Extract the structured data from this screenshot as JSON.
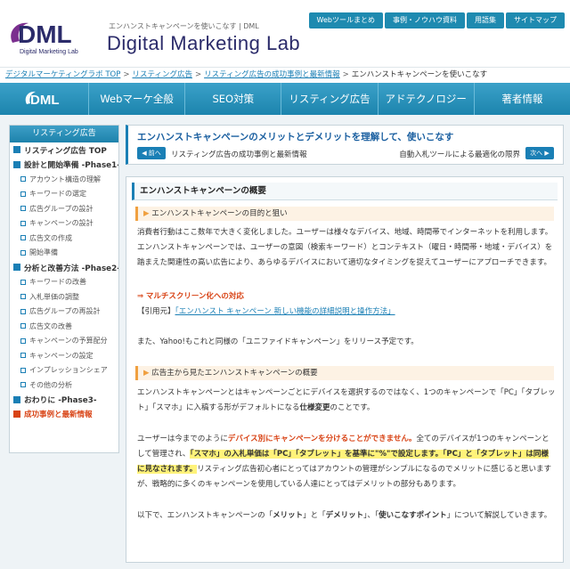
{
  "header": {
    "logo_mark": "DML",
    "logo_subtext": "Digital Marketing Lab",
    "tagline": "エンハンストキャンペーンを使いこなす | DML",
    "site_title": "Digital Marketing Lab",
    "top_nav": [
      "Webツールまとめ",
      "事例・ノウハウ資料",
      "用語集",
      "サイトマップ"
    ]
  },
  "breadcrumb": {
    "items": [
      "デジタルマーケティングラボ TOP",
      "リスティング広告",
      "リスティング広告の成功事例と最新情報"
    ],
    "separator": ">",
    "current": "エンハンストキャンペーンを使いこなす"
  },
  "main_nav": {
    "logo": "DML",
    "items": [
      "Webマーケ全般",
      "SEO対策",
      "リスティング広告",
      "アドテクノロジー",
      "著者情報"
    ]
  },
  "sidebar": {
    "title": "リスティング広告",
    "items": [
      {
        "label": "リスティング広告 TOP",
        "level": "top"
      },
      {
        "label": "設計と開始準備 -Phase1-",
        "level": "top"
      },
      {
        "label": "アカウント構造の理解",
        "level": "sub"
      },
      {
        "label": "キーワードの選定",
        "level": "sub"
      },
      {
        "label": "広告グループの設計",
        "level": "sub"
      },
      {
        "label": "キャンペーンの設計",
        "level": "sub"
      },
      {
        "label": "広告文の作成",
        "level": "sub"
      },
      {
        "label": "開始準備",
        "level": "sub"
      },
      {
        "label": "分析と改善方法 -Phase2-",
        "level": "top"
      },
      {
        "label": "キーワードの改善",
        "level": "sub"
      },
      {
        "label": "入札単価の調整",
        "level": "sub"
      },
      {
        "label": "広告グループの再設計",
        "level": "sub"
      },
      {
        "label": "広告文の改善",
        "level": "sub"
      },
      {
        "label": "キャンペーンの予算配分",
        "level": "sub"
      },
      {
        "label": "キャンペーンの設定",
        "level": "sub"
      },
      {
        "label": "インプレッションシェア",
        "level": "sub"
      },
      {
        "label": "その他の分析",
        "level": "sub"
      },
      {
        "label": "おわりに -Phase3-",
        "level": "top"
      },
      {
        "label": "成功事例と最新情報",
        "level": "accent"
      }
    ]
  },
  "article": {
    "title": "エンハンストキャンペーンのメリットとデメリットを理解して、使いこなす",
    "prev_button": "◀ 前へ",
    "prev_title": "リスティング広告の成功事例と最新情報",
    "next_button": "次へ ▶",
    "next_title": "自動入札ツールによる最適化の限界",
    "section_title": "エンハンストキャンペーンの概要",
    "sub1_title": "エンハンストキャンペーンの目的と狙い",
    "p1": "消費者行動はここ数年で大きく変化しました。ユーザーは様々なデバイス、地域、時間帯でインターネットを利用します。エンハンストキャンペーンでは、ユーザーの意図（検索キーワード）とコンテキスト（曜日・時間帯・地域・デバイス）を踏まえた関連性の高い広告により、あらゆるデバイスにおいて適切なタイミングを捉えてユーザーにアプローチできます。",
    "arrow": "⇒",
    "multiscreen": "マルチスクリーン化への対応",
    "quote_label": "【引用元】",
    "quote_link": "「エンハンスト キャンペーン 新しい機能の詳細説明と操作方法」",
    "p2": "また、Yahoo!もこれと同様の「ユニファイドキャンペーン」をリリース予定です。",
    "sub2_title": "広告主から見たエンハンストキャンペーンの概要",
    "p3_a": "エンハンストキャンペーンとはキャンペーンごとにデバイスを選択するのではなく、1つのキャンペーンで「PC」「タブレット」「スマホ」に入稿する形がデフォルトになる",
    "p3_b": "仕様変更",
    "p3_c": "のことです。",
    "p4_a": "ユーザーは今までのように",
    "p4_b": "デバイス別にキャンペーンを分けることができません。",
    "p4_c": "全てのデバイスが1つのキャンペーンとして管理され、",
    "p4_d": "「スマホ」の入札単価は「PC」「タブレット」を基準に\"%\"で設定します。",
    "p4_e": "「PC」と「タブレット」は同様に見なされます。",
    "p4_f": "リスティング広告初心者にとってはアカウントの管理がシンプルになるのでメリットに感じると思いますが、戦略的に多くのキャンペーンを使用している人達にとってはデメリットの部分もあります。",
    "p5_a": "以下で、エンハンストキャンペーンの「",
    "p5_b": "メリット",
    "p5_c": "」と「",
    "p5_d": "デメリット",
    "p5_e": "」、「",
    "p5_f": "使いこなすポイント",
    "p5_g": "」について解説していきます。"
  },
  "colors": {
    "accent_blue": "#1a7fb5",
    "accent_orange": "#d84315",
    "highlight_yellow": "#fff37a"
  }
}
